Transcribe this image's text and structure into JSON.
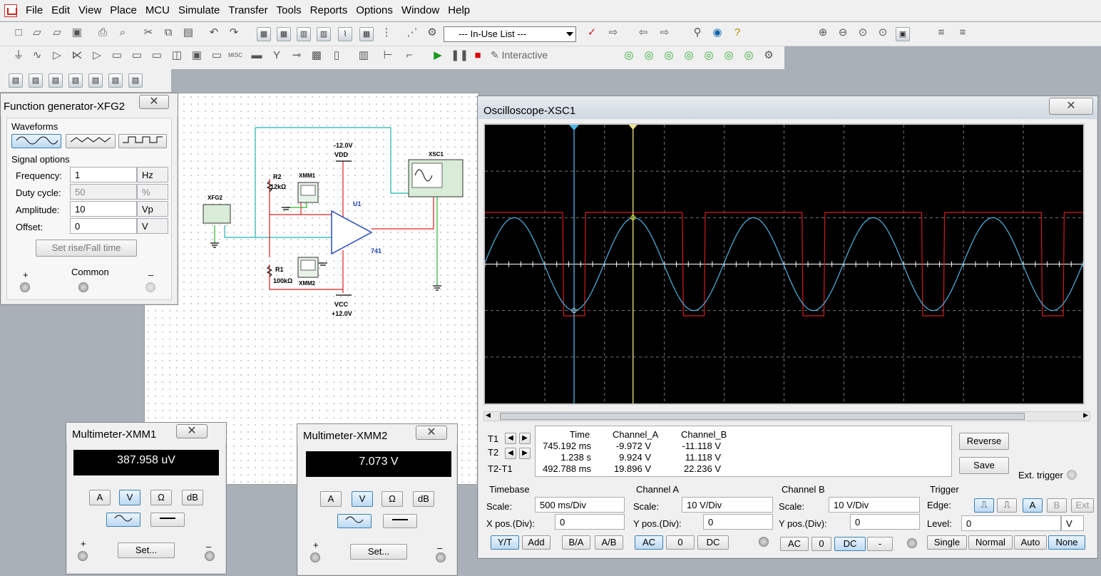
{
  "menu": {
    "items": [
      "File",
      "Edit",
      "View",
      "Place",
      "MCU",
      "Simulate",
      "Transfer",
      "Tools",
      "Reports",
      "Options",
      "Window",
      "Help"
    ]
  },
  "toolbar": {
    "inuse_list": "--- In-Use List ---",
    "interactive": "Interactive"
  },
  "schematic": {
    "labels": {
      "vdd_v": "-12.0V",
      "vdd": "VDD",
      "vcc": "VCC",
      "vcc_v": "+12.0V",
      "r2": "R2",
      "r2_val": "12kΩ",
      "r1": "R1",
      "r1_val": "100kΩ",
      "xmm1": "XMM1",
      "xmm2": "XMM2",
      "u1": "U1",
      "part": "741",
      "xfg2": "XFG2",
      "xsc1": "XSC1"
    }
  },
  "fg": {
    "title": "Function generator-XFG2",
    "waveforms": "Waveforms",
    "signal_options": "Signal options",
    "rows": [
      {
        "label": "Frequency:",
        "value": "1",
        "unit": "Hz"
      },
      {
        "label": "Duty cycle:",
        "value": "50",
        "unit": "%"
      },
      {
        "label": "Amplitude:",
        "value": "10",
        "unit": "Vp"
      },
      {
        "label": "Offset:",
        "value": "0",
        "unit": "V"
      }
    ],
    "set_rise": "Set rise/Fall time",
    "plus": "+",
    "common": "Common",
    "minus": "–"
  },
  "mm1": {
    "title": "Multimeter-XMM1",
    "reading": "387.958 uV",
    "btns": [
      "A",
      "V",
      "Ω",
      "dB"
    ],
    "set": "Set...",
    "plus": "+",
    "minus": "–"
  },
  "mm2": {
    "title": "Multimeter-XMM2",
    "reading": "7.073 V",
    "btns": [
      "A",
      "V",
      "Ω",
      "dB"
    ],
    "set": "Set...",
    "plus": "+",
    "minus": "–"
  },
  "scope": {
    "title": "Oscilloscope-XSC1",
    "readout": {
      "headers": [
        "Time",
        "Channel_A",
        "Channel_B"
      ],
      "rows": [
        {
          "label": "T1",
          "time": "745.192 ms",
          "a": "-9.972 V",
          "b": "-11.118 V"
        },
        {
          "label": "T2",
          "time": "1.238 s",
          "a": "9.924 V",
          "b": "11.118 V"
        },
        {
          "label": "T2-T1",
          "time": "492.788 ms",
          "a": "19.896 V",
          "b": "22.236 V"
        }
      ]
    },
    "reverse": "Reverse",
    "save": "Save",
    "ext_trigger": "Ext. trigger",
    "timebase": {
      "title": "Timebase",
      "scale_label": "Scale:",
      "scale": "500 ms/Div",
      "xpos_label": "X pos.(Div):",
      "xpos": "0",
      "btns": [
        "Y/T",
        "Add",
        "B/A",
        "A/B"
      ]
    },
    "chA": {
      "title": "Channel A",
      "scale_label": "Scale:",
      "scale": "10  V/Div",
      "ypos_label": "Y pos.(Div):",
      "ypos": "0",
      "btns": [
        "AC",
        "0",
        "DC"
      ]
    },
    "chB": {
      "title": "Channel B",
      "scale_label": "Scale:",
      "scale": "10  V/Div",
      "ypos_label": "Y pos.(Div):",
      "ypos": "0",
      "btns": [
        "AC",
        "0",
        "DC",
        "-"
      ]
    },
    "trigger": {
      "title": "Trigger",
      "edge_label": "Edge:",
      "level_label": "Level:",
      "level": "0",
      "level_unit": "V",
      "src": [
        "A",
        "B",
        "Ext"
      ],
      "modes": [
        "Single",
        "Normal",
        "Auto",
        "None"
      ]
    },
    "signal": {
      "freq_hz": 1,
      "amplitude_v": 10,
      "clip_v": 11.118,
      "time_per_div_s": 0.5,
      "volts_per_div": 10,
      "t1_s": 0.745192,
      "t2_s": 1.238,
      "cyan": "#4fb4e6",
      "red": "#d21c1c"
    }
  }
}
